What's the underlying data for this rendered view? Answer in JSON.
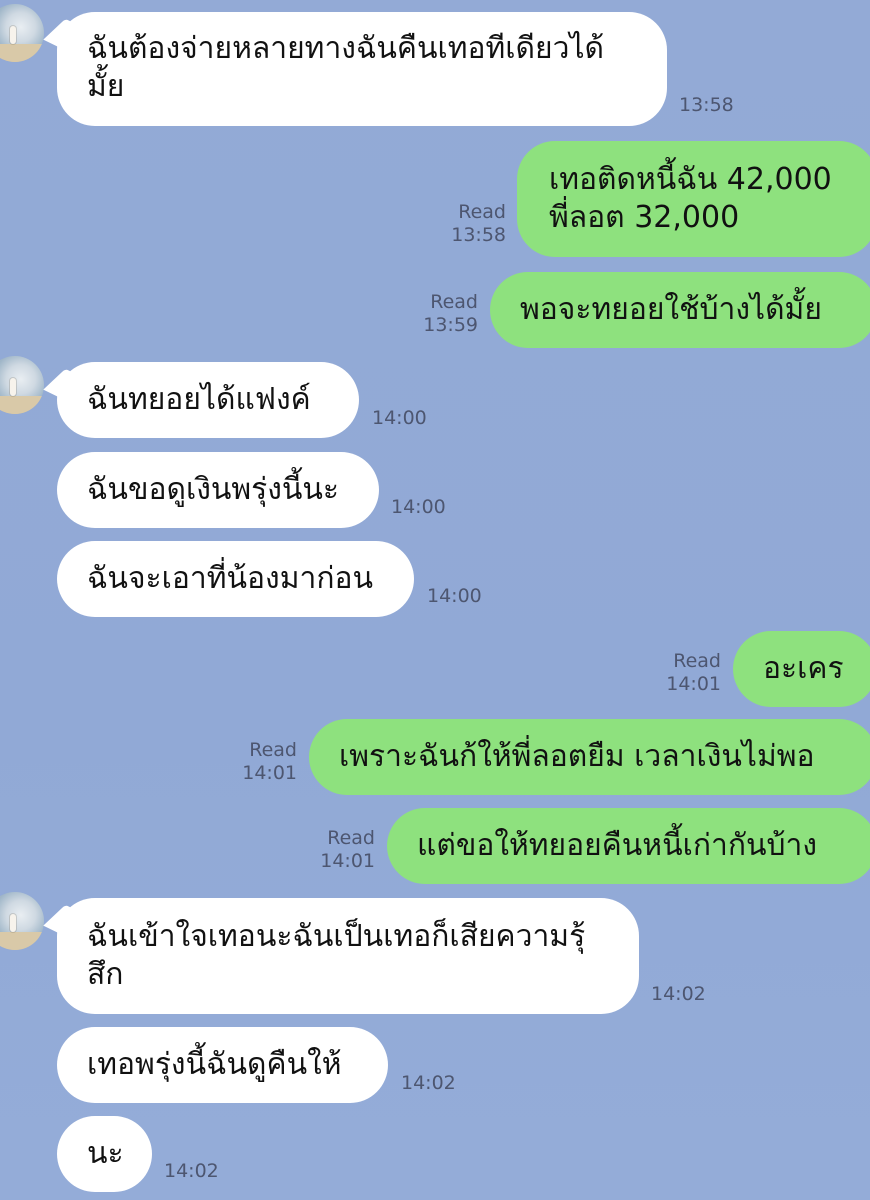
{
  "messages": [
    {
      "dir": "in",
      "lines": [
        "ฉันต้องจ่ายหลายทางฉันคืนเทอทีเดียวได้",
        "มั้ย"
      ],
      "time": "13:58"
    },
    {
      "dir": "out",
      "lines": [
        "เทอติดหนี้ฉัน 42,000",
        "พี่ลอต 32,000"
      ],
      "read": "Read",
      "time": "13:58"
    },
    {
      "dir": "out",
      "lines": [
        "พอจะทยอยใช้บ้างได้มั้ย"
      ],
      "read": "Read",
      "time": "13:59"
    },
    {
      "dir": "in",
      "lines": [
        "ฉันทยอยได้แฟงค์"
      ],
      "time": "14:00"
    },
    {
      "dir": "in",
      "lines": [
        "ฉันขอดูเงินพรุ่งนี้นะ"
      ],
      "time": "14:00"
    },
    {
      "dir": "in",
      "lines": [
        "ฉันจะเอาที่น้องมาก่อน"
      ],
      "time": "14:00"
    },
    {
      "dir": "out",
      "lines": [
        "อะเคร"
      ],
      "read": "Read",
      "time": "14:01"
    },
    {
      "dir": "out",
      "lines": [
        "เพราะฉันก้ให้พี่ลอตยืม เวลาเงินไม่พอ"
      ],
      "read": "Read",
      "time": "14:01"
    },
    {
      "dir": "out",
      "lines": [
        "แต่ขอให้ทยอยคืนหนี้เก่ากันบ้าง"
      ],
      "read": "Read",
      "time": "14:01"
    },
    {
      "dir": "in",
      "lines": [
        "ฉันเข้าใจเทอนะฉันเป็นเทอก็เสียความรุ้",
        "สึก"
      ],
      "time": "14:02"
    },
    {
      "dir": "in",
      "lines": [
        "เทอพรุ่งนี้ฉันดูคืนให้"
      ],
      "time": "14:02"
    },
    {
      "dir": "in",
      "lines": [
        "นะ"
      ],
      "time": "14:02"
    }
  ]
}
